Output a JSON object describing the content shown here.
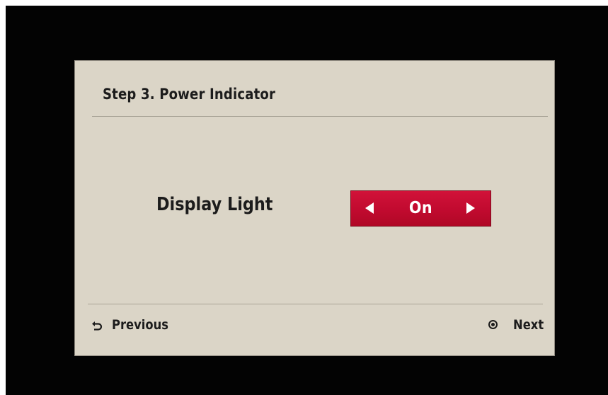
{
  "dialog": {
    "title": "Step 3. Power Indicator"
  },
  "setting": {
    "label": "Display Light",
    "value": "On",
    "left_arrow_icon": "left-arrow-icon",
    "right_arrow_icon": "right-arrow-icon"
  },
  "navigation": {
    "previous_label": "Previous",
    "previous_icon": "back-return-icon",
    "next_label": "Next",
    "next_icon": "ok-button-icon"
  },
  "colors": {
    "screen_background": "#030303",
    "dialog_background": "#dbd5c7",
    "selector_accent": "#c10a2f",
    "text": "#1c1c1c"
  }
}
